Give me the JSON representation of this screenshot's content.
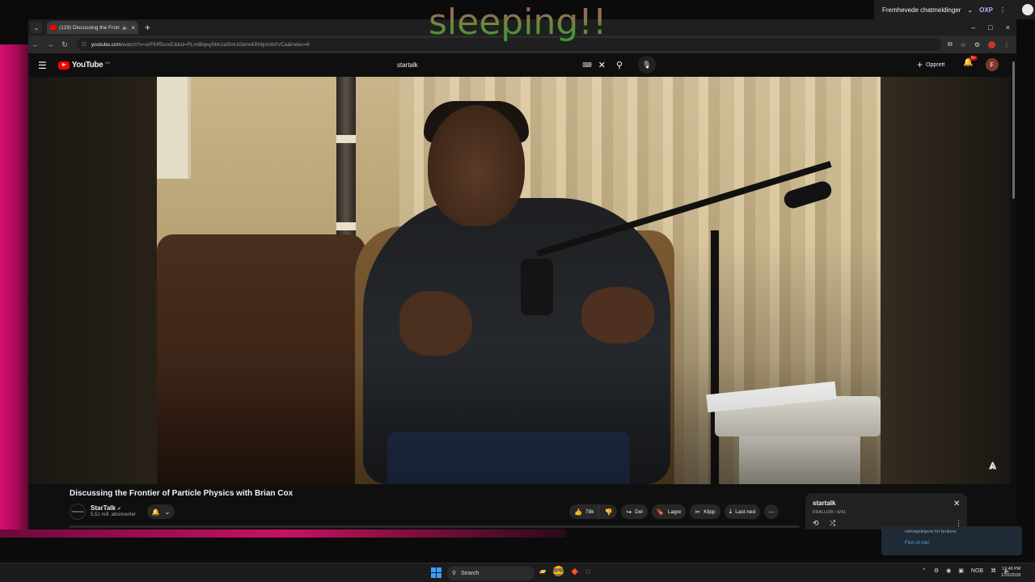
{
  "overlay": {
    "text": "sleeping!!"
  },
  "top_pill": {
    "label": "Fremhevede chatmeldinger",
    "chevron": "⌄",
    "badge": "OXP",
    "menu": "⋮"
  },
  "browser": {
    "tab": {
      "title": "(129) Discussing the Fronti",
      "mute_icon": "🔈",
      "close": "×"
    },
    "new_tab": "+",
    "window_controls": {
      "minimize": "–",
      "maximize": "□",
      "close": "×"
    },
    "nav": {
      "back": "←",
      "forward": "→",
      "reload": "↻"
    },
    "url": {
      "host": "youtube.com",
      "path": "/watch?v=urFlHf5coxE&list=PLmiBqwy5kKzaSmUGbnx4394jnIottXVCa&index=6"
    },
    "extension_label": "F"
  },
  "youtube": {
    "logo_text": "YouTube",
    "logo_country": "NO",
    "search_value": "startalk",
    "keyboard_icon": "⌨",
    "clear_icon": "✕",
    "search_icon": "⚲",
    "mic_icon": "🎙",
    "create_label": "Opprett",
    "notification_count": "9+",
    "avatar_letter": "F"
  },
  "video": {
    "title": "Discussing the Frontier of Particle Physics with Brian Cox",
    "channel": "StarTalk",
    "channel_avatar_text": "STARTALK",
    "verified": "✔",
    "subscribers": "5,51 mill. abonnenter",
    "player_logo": "⩓"
  },
  "actions": {
    "like_count": "78k",
    "share": "Del",
    "save": "Lagre",
    "clip": "Klipp",
    "download": "Last ned",
    "more": "⋯"
  },
  "playlist": {
    "title": "startalk",
    "subtitle": "FRALLOR • 6/41",
    "close": "✕",
    "loop_icon": "⟲",
    "shuffle_icon": "⤮",
    "menu_icon": "⋮"
  },
  "notification": {
    "line1": "retningslinjene for brukere.",
    "link": "Finn ut mer"
  },
  "taskbar": {
    "search_label": "Search",
    "language": "NOB",
    "time": "12:48 PM",
    "date": "1/26/2026"
  }
}
